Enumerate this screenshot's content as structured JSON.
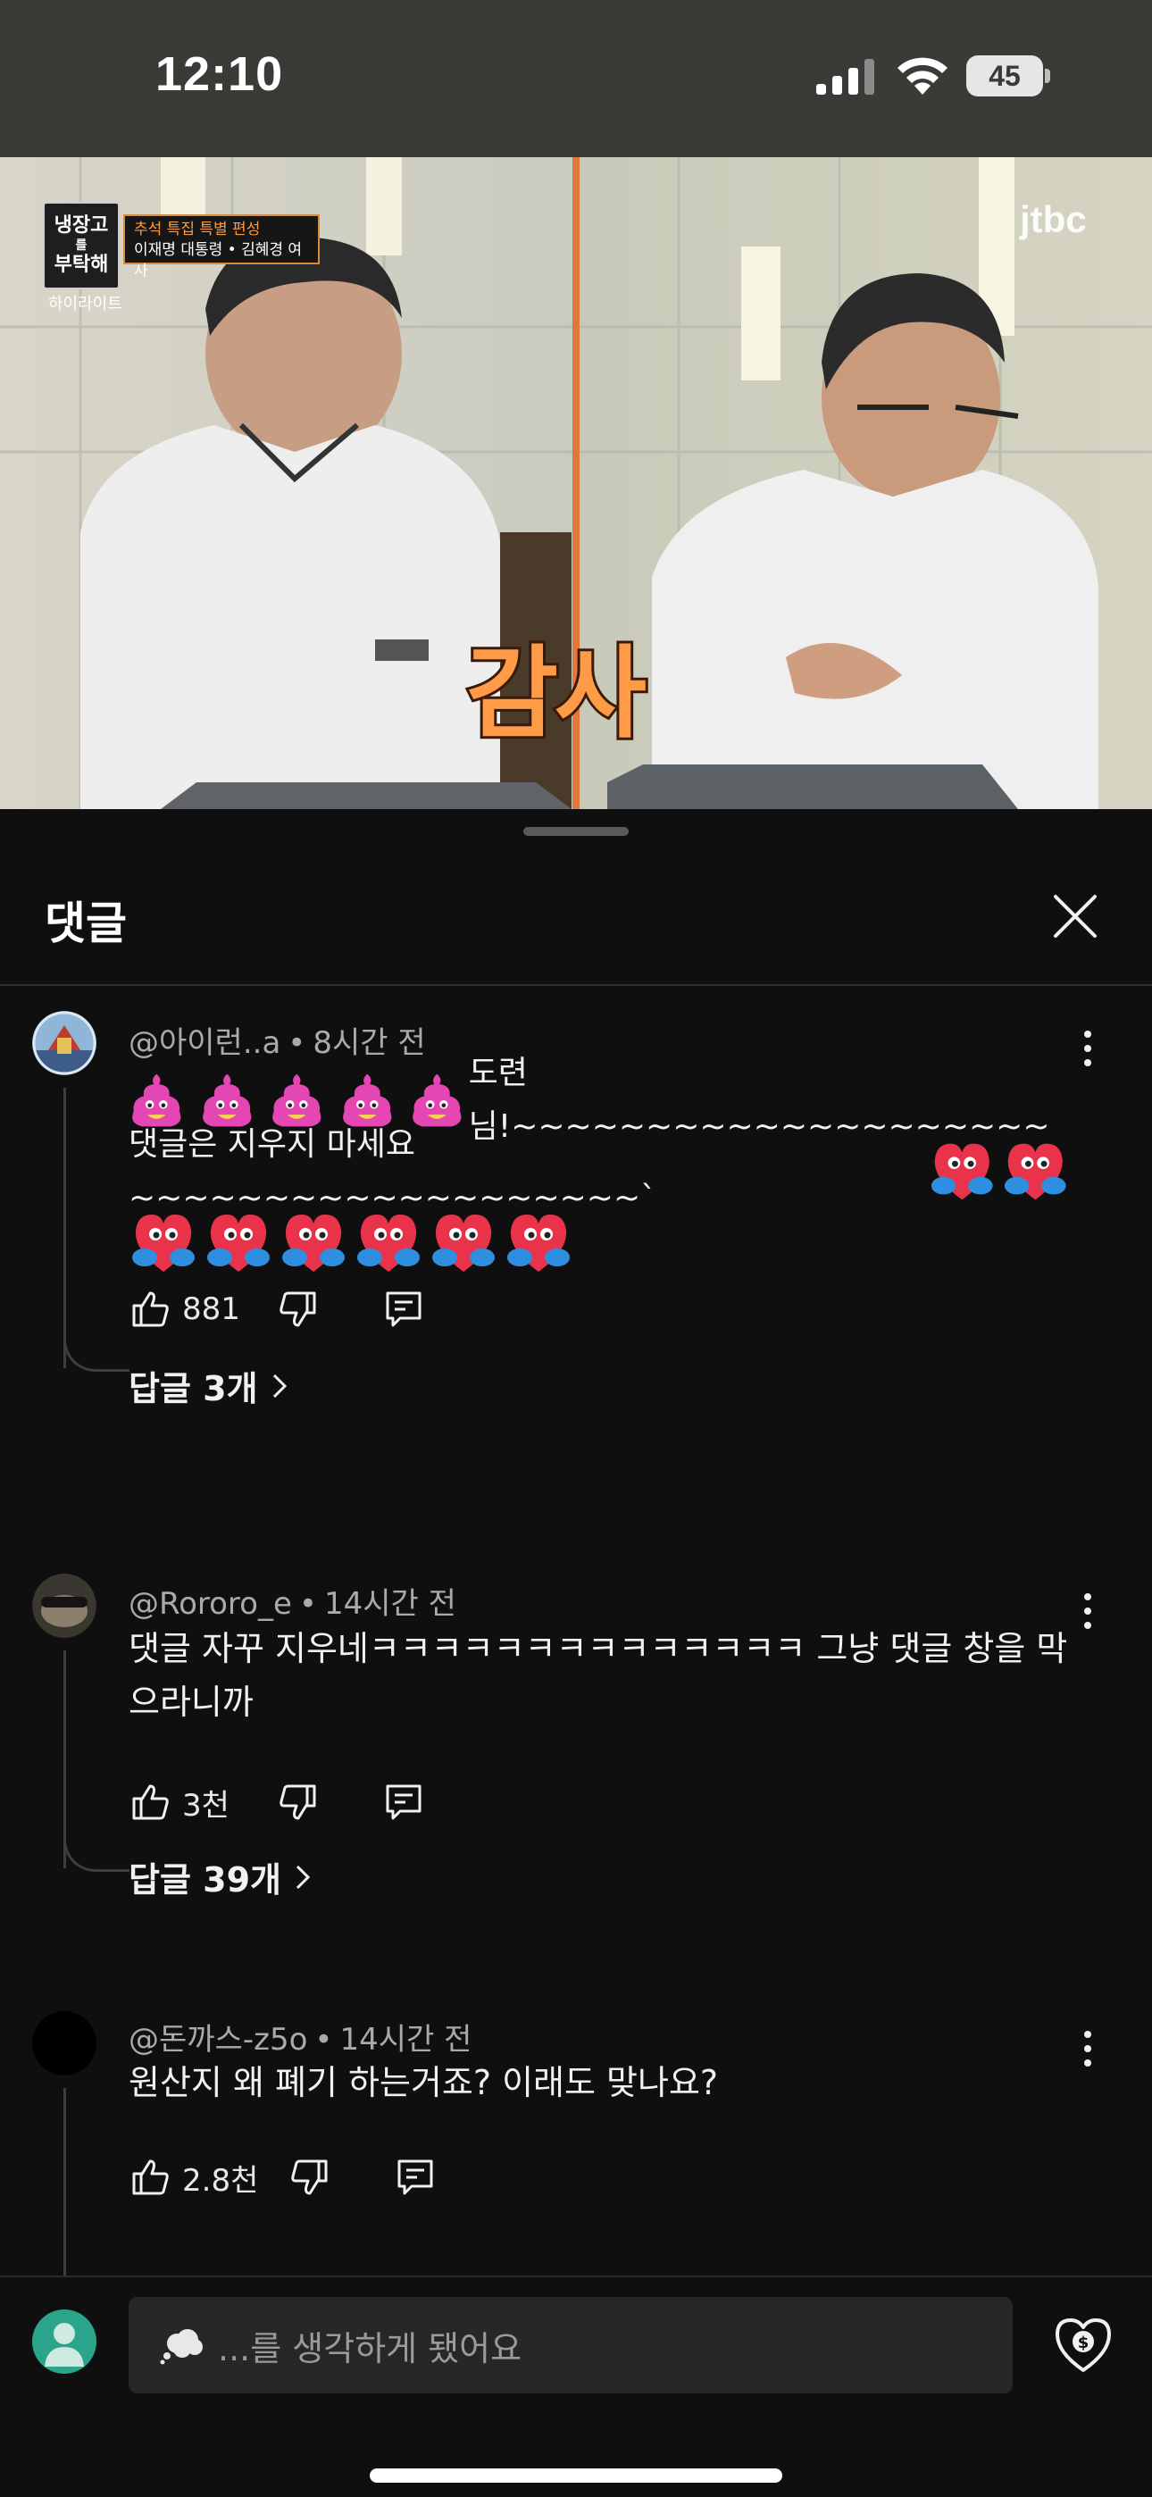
{
  "status_bar": {
    "time": "12:10",
    "battery_level": "45",
    "icons": [
      "cellular-signal-icon",
      "wifi-icon",
      "battery-icon"
    ]
  },
  "video": {
    "show_logo_lines": [
      "냉장고",
      "를",
      "부탁해"
    ],
    "show_logo_sub": "하이라이트",
    "episode_line1": "추석 특집 특별 편성",
    "episode_line2": "이재명 대통령 • 김혜경 여사",
    "channel": "jtbc",
    "caption": "감사"
  },
  "sheet": {
    "title": "댓글",
    "close_icon": "close-icon"
  },
  "comments": [
    {
      "author": "@아이런..a",
      "time": "8시간 전",
      "text_line1": "도련님!~~~~~~~~~~~~~~~~~~~~",
      "text_line2": "댓글은 지우지 마세요~~~~~~~~~~~~~~~~~~~`",
      "likes": "881",
      "replies": "답글 3개"
    },
    {
      "author": "@Rororo_e",
      "time": "14시간 전",
      "text": "댓글 자꾸 지우네ㅋㅋㅋㅋㅋㅋㅋㅋㅋㅋㅋㅋㅋㅋ 그냥 댓글 창을 막으라니까",
      "likes": "3천",
      "replies": "답글 39개"
    },
    {
      "author": "@돈까스-z5o",
      "time": "14시간 전",
      "text": "원산지 왜 폐기 하는거죠? 이래도 맞나요?",
      "likes": "2.8천"
    }
  ],
  "composer": {
    "placeholder": "...를 생각하게 됐어요",
    "thanks_icon": "super-thanks-icon"
  },
  "colors": {
    "background": "#0f0f0f",
    "status_bar": "#3a3b36",
    "input_bg": "#272727",
    "caption_orange": "#ff9a46"
  }
}
